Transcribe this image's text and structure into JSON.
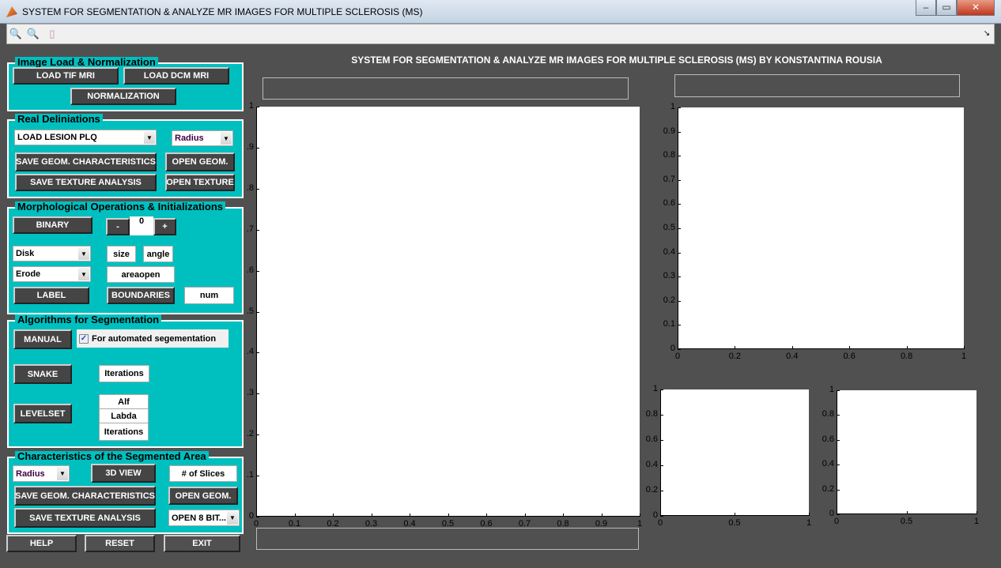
{
  "window": {
    "title": "SYSTEM FOR SEGMENTATION & ANALYZE MR IMAGES FOR MULTIPLE SCLEROSIS (MS)",
    "minimize": "‒",
    "maximize": "▭",
    "close": "✕"
  },
  "toolbar": {
    "zoom_in": "🔍",
    "zoom_out": "🔍",
    "colorbar": "▯",
    "dock": "↘"
  },
  "heading": "SYSTEM FOR SEGMENTATION & ANALYZE MR IMAGES FOR MULTIPLE SCLEROSIS (MS) BY KONSTANTINA ROUSIA",
  "panels": {
    "load": {
      "title": "Image Load & Normalization",
      "load_tif": "LOAD TIF MRI",
      "load_dcm": "LOAD DCM MRI",
      "normalization": "NORMALIZATION"
    },
    "real": {
      "title": "Real Deliniations",
      "lesion_select": "LOAD LESION PLQ",
      "radius_select": "Radius",
      "save_geom": "SAVE GEOM. CHARACTERISTICS",
      "open_geom": "OPEN GEOM.",
      "save_texture": "SAVE TEXTURE ANALYSIS",
      "open_texture": "OPEN TEXTURE"
    },
    "morph": {
      "title": "Morphological Operations & Initializations",
      "binary": "BINARY",
      "minus": "-",
      "value": "0",
      "plus": "+",
      "shape_select": "Disk",
      "size": "size",
      "angle": "angle",
      "op_select": "Erode",
      "areaopen": "areaopen",
      "label": "LABEL",
      "boundaries": "BOUNDARIES",
      "num": "num"
    },
    "algo": {
      "title": "Algorithms for Segmentation",
      "manual": "MANUAL",
      "auto_label": "For automated segementation",
      "auto_checked": true,
      "snake": "SNAKE",
      "snake_iter": "Iterations",
      "levelset": "LEVELSET",
      "alf": "Alf",
      "labda": "Labda",
      "ls_iter": "Iterations"
    },
    "chars": {
      "title": "Characteristics of the Segmented Area",
      "radius_select": "Radius",
      "view3d": "3D VIEW",
      "slices": "# of Slices",
      "save_geom": "SAVE GEOM. CHARACTERISTICS",
      "open_geom": "OPEN GEOM.",
      "save_texture": "SAVE TEXTURE ANALYSIS",
      "open8bit_select": "OPEN 8 BIT..."
    }
  },
  "bottom": {
    "help": "HELP",
    "reset": "RESET",
    "exit": "EXIT"
  },
  "axes": {
    "main": {
      "xticks": [
        "0",
        "0.1",
        "0.2",
        "0.3",
        "0.4",
        "0.5",
        "0.6",
        "0.7",
        "0.8",
        "0.9",
        "1"
      ],
      "yticks": [
        "0",
        ".1",
        ".2",
        ".3",
        ".4",
        ".5",
        ".6",
        ".7",
        ".8",
        ".9",
        "1"
      ]
    },
    "top_right": {
      "xticks": [
        "0",
        "0.2",
        "0.4",
        "0.6",
        "0.8",
        "1"
      ],
      "yticks": [
        "0",
        "0.1",
        "0.2",
        "0.3",
        "0.4",
        "0.5",
        "0.6",
        "0.7",
        "0.8",
        "0.9",
        "1"
      ]
    },
    "bottom_left": {
      "xticks": [
        "0",
        "0.5",
        "1"
      ],
      "yticks": [
        "0",
        "0.2",
        "0.4",
        "0.6",
        "0.8",
        "1"
      ]
    },
    "bottom_right": {
      "xticks": [
        "0",
        "0.5",
        "1"
      ],
      "yticks": [
        "0",
        "0.2",
        "0.4",
        "0.6",
        "0.8",
        "1"
      ]
    }
  },
  "colors": {
    "panel": "#00bfbf",
    "background": "#505050",
    "button": "#454545"
  }
}
